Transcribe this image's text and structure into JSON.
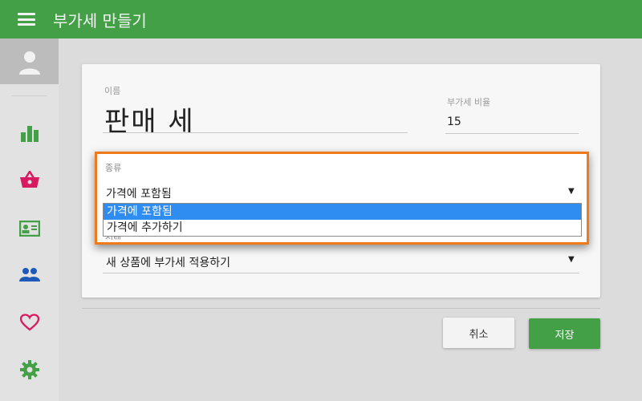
{
  "header": {
    "title": "부가세 만들기"
  },
  "form": {
    "name_label": "이름",
    "name_value": "판매 세",
    "rate_label": "부가세 비율",
    "rate_value": "15",
    "type_label": "종류",
    "type_value": "가격에 포함됨",
    "type_options": [
      "가격에 포함됨",
      "가격에 추가하기"
    ],
    "select_label": "선택",
    "select_value": "새 상품에 부가세 적용하기"
  },
  "actions": {
    "cancel_label": "취소",
    "save_label": "저장"
  },
  "sidebar": {
    "items": [
      {
        "name": "chart-icon",
        "color": "#43a047"
      },
      {
        "name": "basket-icon",
        "color": "#d81b60"
      },
      {
        "name": "contact-card-icon",
        "color": "#43a047"
      },
      {
        "name": "people-icon",
        "color": "#1e5bb8"
      },
      {
        "name": "heart-icon",
        "color": "#d81b60"
      },
      {
        "name": "gear-icon",
        "color": "#43a047"
      }
    ]
  },
  "colors": {
    "accent": "#43a047",
    "highlight": "#f07a1a",
    "selection": "#2f8cf0"
  }
}
